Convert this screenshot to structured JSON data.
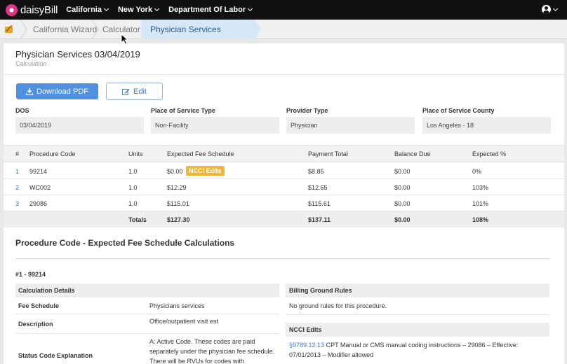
{
  "nav": {
    "logo_text": "daisyBill",
    "menus": [
      "California",
      "New York",
      "Department Of Labor"
    ]
  },
  "breadcrumb": {
    "items": [
      "California Wizard",
      "Calculator"
    ],
    "active": "Physician Services 03/04/2019"
  },
  "page": {
    "title": "Physician Services 03/04/2019",
    "subtitle": "Calculation"
  },
  "buttons": {
    "download": "Download PDF",
    "edit": "Edit"
  },
  "fields": [
    {
      "label": "DOS",
      "value": "03/04/2019"
    },
    {
      "label": "Place of Service Type",
      "value": "Non-Facility"
    },
    {
      "label": "Provider Type",
      "value": "Physician"
    },
    {
      "label": "Place of Service County",
      "value": "Los Angeles - 18"
    }
  ],
  "table": {
    "headers": [
      "#",
      "Procedure Code",
      "Units",
      "Expected Fee Schedule",
      "Payment Total",
      "Balance Due",
      "Expected %"
    ],
    "rows": [
      {
        "n": "1",
        "code": "99214",
        "units": "1.0",
        "fee": "$0.00",
        "badge": "NCCI Edits",
        "payment": "$8.85",
        "balance": "$0.00",
        "pct": "0%"
      },
      {
        "n": "2",
        "code": "WC002",
        "units": "1.0",
        "fee": "$12.29",
        "badge": "",
        "payment": "$12.65",
        "balance": "$0.00",
        "pct": "103%"
      },
      {
        "n": "3",
        "code": "29086",
        "units": "1.0",
        "fee": "$115.01",
        "badge": "",
        "payment": "$115.61",
        "balance": "$0.00",
        "pct": "101%"
      }
    ],
    "totals": {
      "label": "Totals",
      "fee": "$127.30",
      "payment": "$137.11",
      "balance": "$0.00",
      "pct": "108%"
    }
  },
  "calc_section": {
    "title": "Procedure Code - Expected Fee Schedule Calculations",
    "item_title": "#1 - 99214",
    "details_header": "Calculation Details",
    "details": [
      {
        "key": "Fee Schedule",
        "value": "Physicians services"
      },
      {
        "key": "Description",
        "value": "Office/outpatient visit est"
      },
      {
        "key": "Status Code Explanation",
        "value": "A: Active Code. These codes are paid separately under the physician fee schedule. There will be RVUs for codes with"
      }
    ],
    "rules_header": "Billing Ground Rules",
    "rules_text": "No ground rules for this procedure.",
    "ncci_header": "NCCI Edits",
    "ncci_link": "§9789.12.13",
    "ncci_text": " CPT Manual or CMS manual coding instructions – 29086 – Effective: 07/01/2013 – Modifier allowed"
  },
  "colors": {
    "primary": "#4f91e0",
    "badge": "#f0b631",
    "nav_bg": "#111111",
    "breadcrumb_active": "#d6e7f7"
  }
}
